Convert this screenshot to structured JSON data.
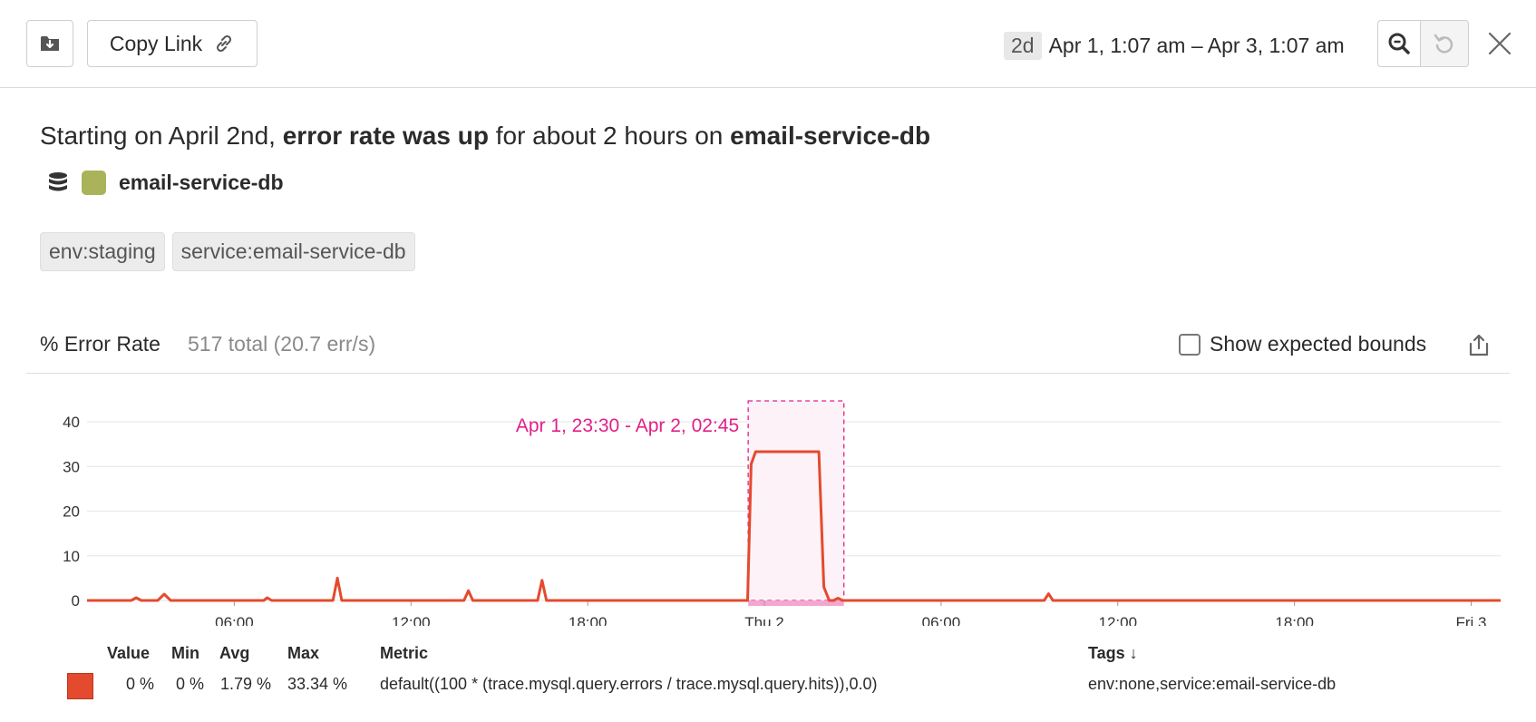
{
  "toolbar": {
    "copy_link_label": "Copy Link",
    "time_badge": "2d",
    "time_range": "Apr 1, 1:07 am – Apr 3, 1:07 am"
  },
  "summary": {
    "prefix": "Starting on April 2nd, ",
    "strong1": "error rate was up",
    "middle": " for about 2 hours on ",
    "strong2": "email-service-db"
  },
  "service": {
    "name": "email-service-db",
    "icon": "database-icon",
    "color": "#aab35a"
  },
  "tags": [
    "env:staging",
    "service:email-service-db"
  ],
  "chart_header": {
    "title": "% Error Rate",
    "subtitle": "517 total (20.7 err/s)",
    "bounds_label": "Show expected bounds"
  },
  "chart_data": {
    "type": "line",
    "title": "% Error Rate",
    "xlabel": "",
    "ylabel": "",
    "ylim": [
      0,
      40
    ],
    "yticks": [
      0,
      10,
      20,
      30,
      40
    ],
    "x_range_hours": [
      0,
      48
    ],
    "xticks": [
      {
        "hour": 5,
        "label": "06:00"
      },
      {
        "hour": 11,
        "label": "12:00"
      },
      {
        "hour": 17,
        "label": "18:00"
      },
      {
        "hour": 23,
        "label": "Thu 2"
      },
      {
        "hour": 29,
        "label": "06:00"
      },
      {
        "hour": 35,
        "label": "12:00"
      },
      {
        "hour": 41,
        "label": "18:00"
      },
      {
        "hour": 47,
        "label": "Fri 3"
      }
    ],
    "grid": true,
    "series": [
      {
        "color": "#e44a2e",
        "points": [
          [
            0,
            0
          ],
          [
            1.5,
            0
          ],
          [
            1.67,
            0.6
          ],
          [
            1.84,
            0
          ],
          [
            2.4,
            0
          ],
          [
            2.62,
            1.4
          ],
          [
            2.84,
            0
          ],
          [
            6,
            0
          ],
          [
            6.12,
            0.6
          ],
          [
            6.27,
            0
          ],
          [
            8.35,
            0
          ],
          [
            8.5,
            5
          ],
          [
            8.65,
            0
          ],
          [
            12.8,
            0
          ],
          [
            12.95,
            2.2
          ],
          [
            13.1,
            0
          ],
          [
            15.3,
            0
          ],
          [
            15.45,
            4.5
          ],
          [
            15.6,
            0
          ],
          [
            22.3,
            0
          ],
          [
            22.43,
            0
          ],
          [
            22.55,
            30.5
          ],
          [
            22.7,
            33.3
          ],
          [
            24.85,
            33.3
          ],
          [
            25.02,
            3
          ],
          [
            25.2,
            0
          ],
          [
            25.35,
            0
          ],
          [
            25.5,
            0.5
          ],
          [
            25.65,
            0
          ],
          [
            32.5,
            0
          ],
          [
            32.65,
            1.5
          ],
          [
            32.8,
            0
          ],
          [
            48,
            0
          ]
        ]
      }
    ],
    "highlight": {
      "start_hour": 22.45,
      "end_hour": 25.7,
      "label": "Apr 1, 23:30 - Apr 2, 02:45",
      "color": "#e0218a"
    }
  },
  "legend": {
    "headers": {
      "value": "Value",
      "min": "Min",
      "avg": "Avg",
      "max": "Max",
      "metric": "Metric",
      "tags": "Tags ↓"
    },
    "row": {
      "color": "#e44a2e",
      "value": "0 %",
      "min": "0 %",
      "avg": "1.79 %",
      "max": "33.34 %",
      "metric": "default((100 * (trace.mysql.query.errors / trace.mysql.query.hits)),0.0)",
      "tags": "env:none,service:email-service-db"
    }
  }
}
